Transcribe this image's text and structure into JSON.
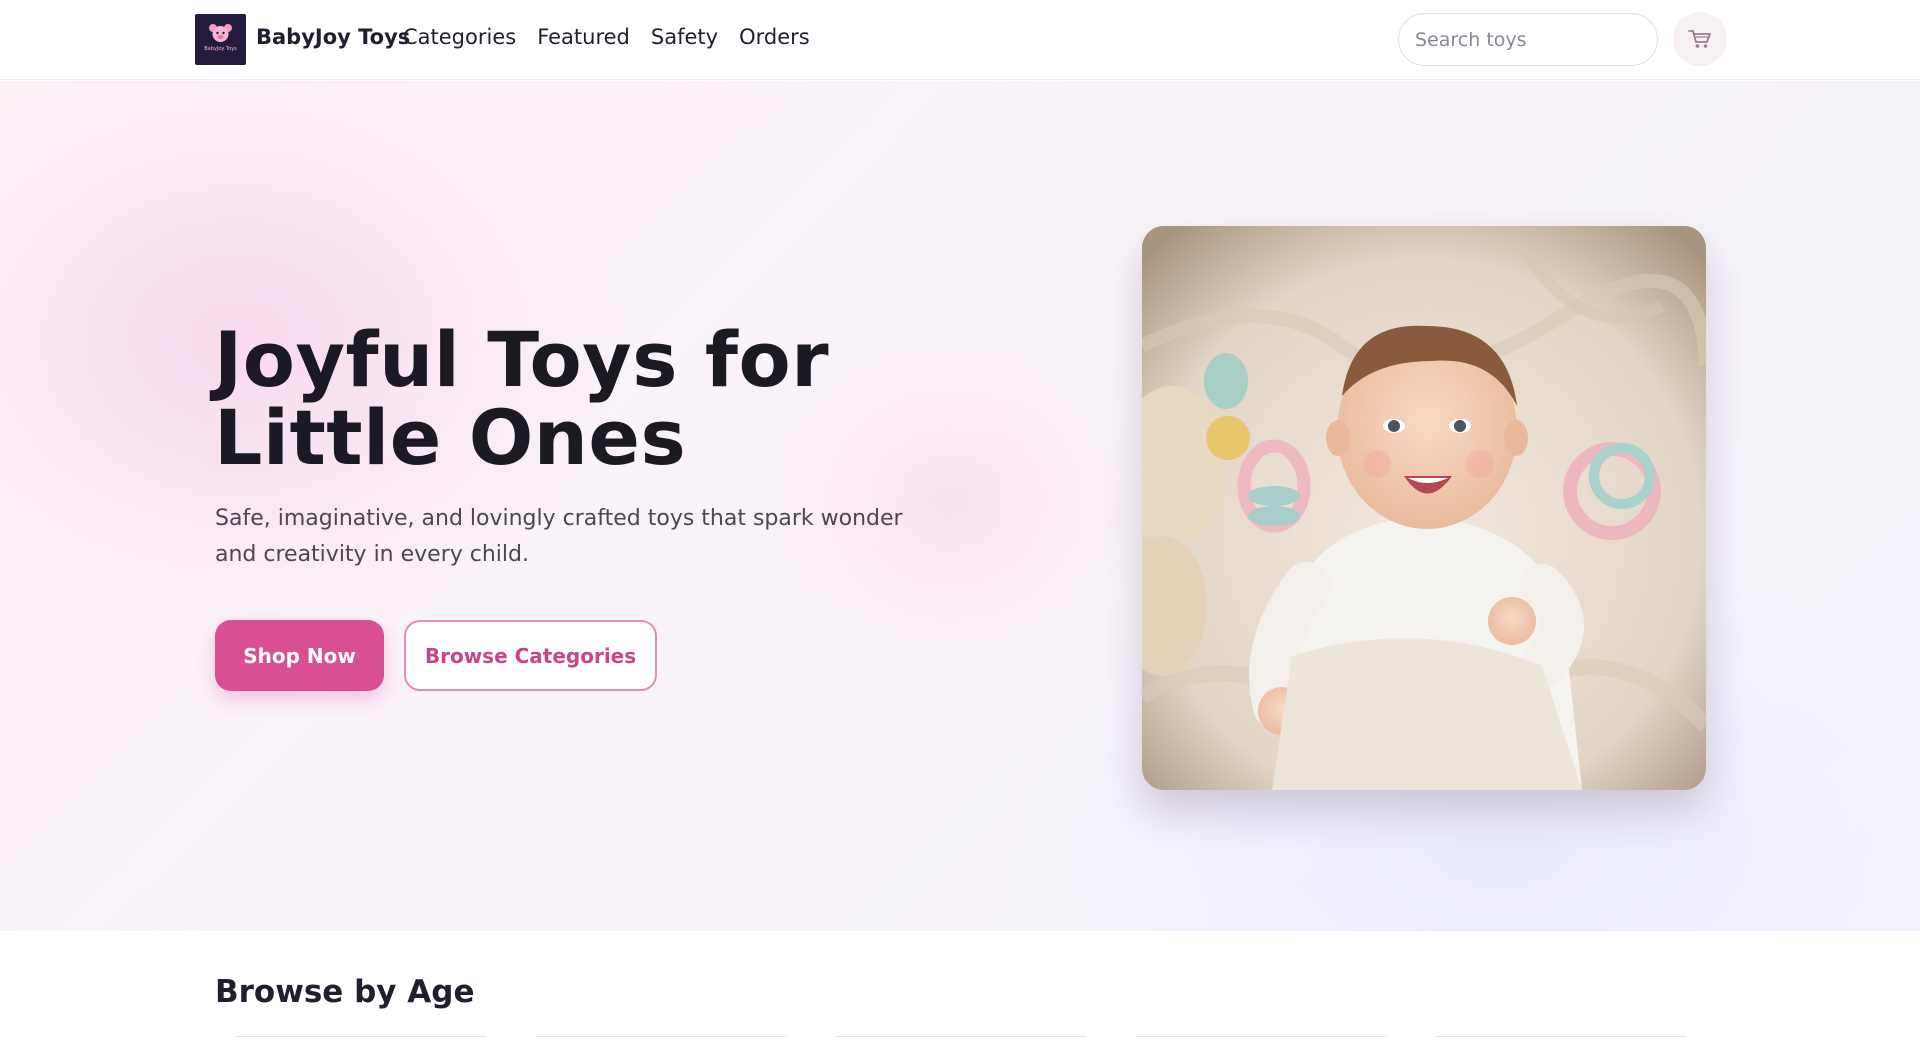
{
  "header": {
    "brand": "BabyJoy Toys",
    "logo_text": "BabyJoy Toys",
    "nav": [
      "Categories",
      "Featured",
      "Safety",
      "Orders"
    ],
    "search_placeholder": "Search toys",
    "cart_icon": "cart-icon"
  },
  "hero": {
    "title": "Joyful Toys for Little Ones",
    "subtitle": "Safe, imaginative, and lovingly crafted toys that spark wonder and creativity in every child.",
    "primary_button": "Shop Now",
    "secondary_button": "Browse Categories",
    "image": "baby-photo"
  },
  "browse": {
    "title": "Browse by Age"
  },
  "colors": {
    "accent": "#d94f93",
    "accent_border": "#e58bb7",
    "logo_bg": "#241b3d",
    "text": "#1f1f2e"
  }
}
